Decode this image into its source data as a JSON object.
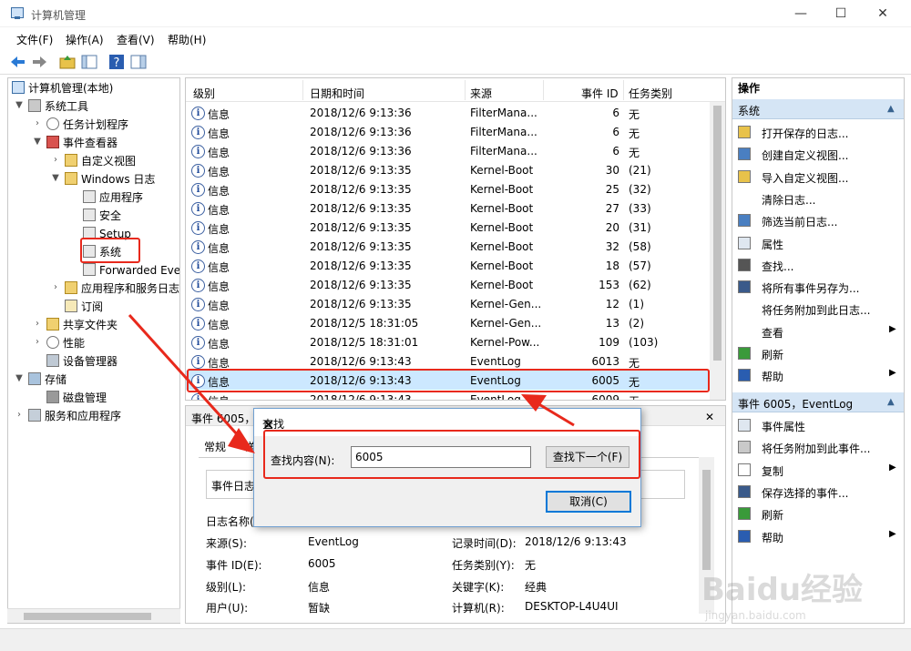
{
  "window": {
    "title": "计算机管理",
    "minimize": "—",
    "maximize": "☐",
    "close": "✕"
  },
  "menu": [
    "文件(F)",
    "操作(A)",
    "查看(V)",
    "帮助(H)"
  ],
  "tree": {
    "root": "计算机管理(本地)",
    "system_tools": "系统工具",
    "task_scheduler": "任务计划程序",
    "event_viewer": "事件查看器",
    "custom_views": "自定义视图",
    "windows_logs": "Windows 日志",
    "application": "应用程序",
    "security": "安全",
    "setup": "Setup",
    "system": "系统",
    "forwarded": "Forwarded Eve",
    "apps_services_logs": "应用程序和服务日志",
    "subscriptions": "订阅",
    "shared_folders": "共享文件夹",
    "performance": "性能",
    "device_manager": "设备管理器",
    "storage": "存储",
    "disk_management": "磁盘管理",
    "services_apps": "服务和应用程序"
  },
  "list": {
    "headers": [
      "级别",
      "日期和时间",
      "来源",
      "事件 ID",
      "任务类别"
    ],
    "rows": [
      {
        "level": "信息",
        "date": "2018/12/6 9:13:36",
        "source": "FilterMana...",
        "id": "6",
        "cat": "无"
      },
      {
        "level": "信息",
        "date": "2018/12/6 9:13:36",
        "source": "FilterMana...",
        "id": "6",
        "cat": "无"
      },
      {
        "level": "信息",
        "date": "2018/12/6 9:13:36",
        "source": "FilterMana...",
        "id": "6",
        "cat": "无"
      },
      {
        "level": "信息",
        "date": "2018/12/6 9:13:35",
        "source": "Kernel-Boot",
        "id": "30",
        "cat": "(21)"
      },
      {
        "level": "信息",
        "date": "2018/12/6 9:13:35",
        "source": "Kernel-Boot",
        "id": "25",
        "cat": "(32)"
      },
      {
        "level": "信息",
        "date": "2018/12/6 9:13:35",
        "source": "Kernel-Boot",
        "id": "27",
        "cat": "(33)"
      },
      {
        "level": "信息",
        "date": "2018/12/6 9:13:35",
        "source": "Kernel-Boot",
        "id": "20",
        "cat": "(31)"
      },
      {
        "level": "信息",
        "date": "2018/12/6 9:13:35",
        "source": "Kernel-Boot",
        "id": "32",
        "cat": "(58)"
      },
      {
        "level": "信息",
        "date": "2018/12/6 9:13:35",
        "source": "Kernel-Boot",
        "id": "18",
        "cat": "(57)"
      },
      {
        "level": "信息",
        "date": "2018/12/6 9:13:35",
        "source": "Kernel-Boot",
        "id": "153",
        "cat": "(62)"
      },
      {
        "level": "信息",
        "date": "2018/12/6 9:13:35",
        "source": "Kernel-Gen...",
        "id": "12",
        "cat": "(1)"
      },
      {
        "level": "信息",
        "date": "2018/12/5 18:31:05",
        "source": "Kernel-Gen...",
        "id": "13",
        "cat": "(2)"
      },
      {
        "level": "信息",
        "date": "2018/12/5 18:31:01",
        "source": "Kernel-Pow...",
        "id": "109",
        "cat": "(103)"
      },
      {
        "level": "信息",
        "date": "2018/12/6 9:13:43",
        "source": "EventLog",
        "id": "6013",
        "cat": "无"
      },
      {
        "level": "信息",
        "date": "2018/12/6 9:13:43",
        "source": "EventLog",
        "id": "6005",
        "cat": "无"
      },
      {
        "level": "信息",
        "date": "2018/12/6 9:13:43",
        "source": "EventLog",
        "id": "6009",
        "cat": "无"
      }
    ]
  },
  "detail": {
    "title": "事件 6005，E",
    "tab_general": "常规",
    "tab_details": "详",
    "desc_label": "事件日志",
    "logname_label": "日志名称(",
    "source_label": "来源(S):",
    "source_value": "EventLog",
    "logged_label": "记录时间(D):",
    "logged_value": "2018/12/6 9:13:43",
    "eventid_label": "事件 ID(E):",
    "eventid_value": "6005",
    "taskcat_label": "任务类别(Y):",
    "taskcat_value": "无",
    "level_label": "级别(L):",
    "level_value": "信息",
    "keywords_label": "关键字(K):",
    "keywords_value": "经典",
    "user_label": "用户(U):",
    "user_value": "暂缺",
    "computer_label": "计算机(R):",
    "computer_value": "DESKTOP-L4U4UI"
  },
  "actions": {
    "header": "操作",
    "section1": "系统",
    "items1": [
      {
        "label": "打开保存的日志...",
        "icon": "folder-open-icon"
      },
      {
        "label": "创建自定义视图...",
        "icon": "filter-icon"
      },
      {
        "label": "导入自定义视图...",
        "icon": "import-icon"
      },
      {
        "label": "清除日志...",
        "icon": "none"
      },
      {
        "label": "筛选当前日志...",
        "icon": "filter-icon"
      },
      {
        "label": "属性",
        "icon": "properties-icon"
      },
      {
        "label": "查找...",
        "icon": "binoculars-icon"
      },
      {
        "label": "将所有事件另存为...",
        "icon": "save-icon"
      },
      {
        "label": "将任务附加到此日志...",
        "icon": "none"
      },
      {
        "label": "查看",
        "icon": "none"
      },
      {
        "label": "刷新",
        "icon": "refresh-icon"
      },
      {
        "label": "帮助",
        "icon": "help-icon"
      }
    ],
    "section2": "事件 6005，EventLog",
    "items2": [
      {
        "label": "事件属性",
        "icon": "properties-icon"
      },
      {
        "label": "将任务附加到此事件...",
        "icon": "task-icon"
      },
      {
        "label": "复制",
        "icon": "copy-icon"
      },
      {
        "label": "保存选择的事件...",
        "icon": "save-icon"
      },
      {
        "label": "刷新",
        "icon": "refresh-icon"
      },
      {
        "label": "帮助",
        "icon": "help-icon"
      }
    ]
  },
  "find_dialog": {
    "title": "查找",
    "label": "查找内容(N):",
    "value": "6005",
    "find_next": "查找下一个(F)",
    "cancel": "取消(C)"
  },
  "watermark": "Baidu经验",
  "watermark_url": "jingyan.baidu.com",
  "colors": {
    "accent": "#0078d7",
    "highlight": "#e8291c",
    "selection": "#cce8ff",
    "section": "#d5e5f5"
  }
}
